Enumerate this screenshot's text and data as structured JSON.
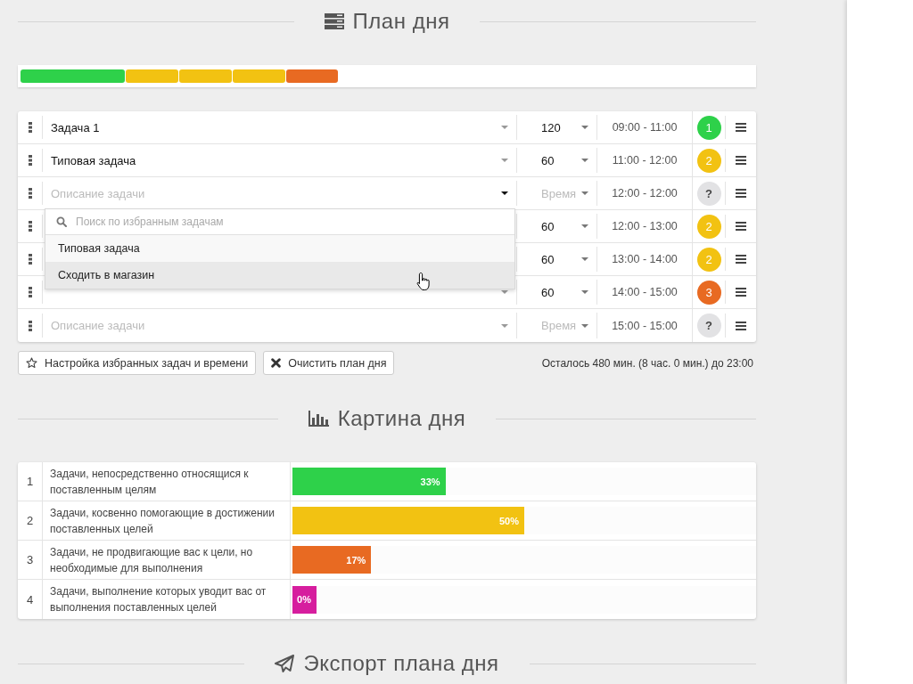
{
  "plan_heading": "План дня",
  "rows": [
    {
      "task": "Задача 1",
      "duration": "120",
      "time": "09:00 - 11:00",
      "category": "1",
      "color": "#2ed14a"
    },
    {
      "task": "Типовая задача",
      "duration": "60",
      "time": "11:00 - 12:00",
      "category": "2",
      "color": "#f2c212"
    },
    {
      "task_placeholder": "Описание задачи",
      "duration_placeholder": "Время",
      "time": "12:00 - 12:00",
      "category": "?",
      "color": "#e2e2e4",
      "dropdown": {
        "search": {
          "placeholder": "Поиск по избранным задачам"
        },
        "options": [
          {
            "label": "Типовая задача",
            "selected": false
          },
          {
            "label": "Сходить в магазин",
            "selected": true
          }
        ]
      }
    },
    {
      "duration": "60",
      "time": "12:00 - 13:00",
      "category": "2",
      "color": "#f2c212"
    },
    {
      "duration": "60",
      "time": "13:00 - 14:00",
      "category": "2",
      "color": "#f2c212"
    },
    {
      "duration": "60",
      "time": "14:00 - 15:00",
      "category": "3",
      "color": "#e86a22"
    },
    {
      "task_placeholder": "Описание задачи",
      "duration_placeholder": "Время",
      "time": "15:00 - 15:00",
      "category": "?",
      "color": "#e2e2e4"
    }
  ],
  "buttons": [
    {
      "kind": "favorites",
      "label": "Настройка избранных задач и времени"
    },
    {
      "kind": "clear",
      "label": "Очистить план дня"
    }
  ],
  "remaining": "Осталось 480 мин. (8 час. 0 мин.) до 23:00",
  "picture_heading": "Картина дня",
  "categories": [
    {
      "number": "1",
      "text": "Задачи, непосредственно относящися к поставленным целям",
      "level": 0.33,
      "value": "33%",
      "color": "#2ed14a"
    },
    {
      "number": "2",
      "text": "Задачи, косвенно помогающие в достижении поставленных целей",
      "level": 0.5,
      "value": "50%",
      "color": "#f2c212"
    },
    {
      "number": "3",
      "text": "Задачи, не продвигающие вас к цели, но необходимые для выполнения",
      "level": 0.17,
      "value": "17%",
      "color": "#e86a22"
    },
    {
      "number": "4",
      "text": "Задачи, выполнение которых уводит вас от выполнения поставленных целей",
      "level": 0,
      "value": "0%",
      "color": "#d61e9e"
    }
  ],
  "export_heading": "Экспорт плана дня"
}
